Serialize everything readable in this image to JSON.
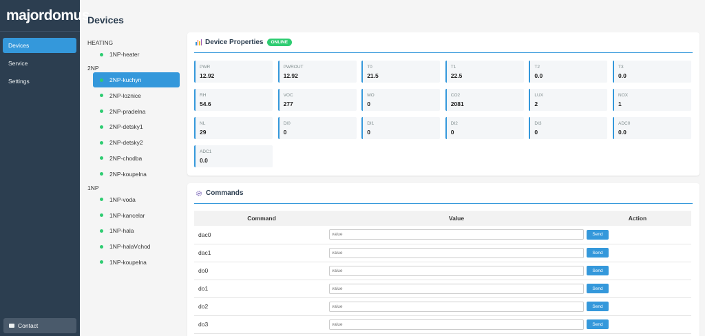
{
  "app": {
    "logo": "majordomus"
  },
  "sidebar": {
    "items": [
      {
        "label": "Devices",
        "active": true
      },
      {
        "label": "Service"
      },
      {
        "label": "Settings"
      }
    ],
    "contact_label": "Contact"
  },
  "page": {
    "title": "Devices"
  },
  "tree": {
    "groups": [
      {
        "label": "HEATING",
        "devices": [
          "1NP-heater"
        ]
      },
      {
        "label": "2NP",
        "devices": [
          "2NP-kuchyn",
          "2NP-loznice",
          "2NP-pradelna",
          "2NP-detsky1",
          "2NP-detsky2",
          "2NP-chodba",
          "2NP-koupelna"
        ]
      },
      {
        "label": "1NP",
        "devices": [
          "1NP-voda",
          "1NP-kancelar",
          "1NP-hala",
          "1NP-halaVchod",
          "1NP-koupelna"
        ]
      }
    ],
    "selected": "2NP-kuchyn"
  },
  "properties": {
    "title": "Device Properties",
    "status": "ONLINE",
    "items": [
      {
        "name": "PWR",
        "value": "12.92"
      },
      {
        "name": "PWROUT",
        "value": "12.92"
      },
      {
        "name": "T0",
        "value": "21.5"
      },
      {
        "name": "T1",
        "value": "22.5"
      },
      {
        "name": "T2",
        "value": "0.0"
      },
      {
        "name": "T3",
        "value": "0.0"
      },
      {
        "name": "RH",
        "value": "54.6"
      },
      {
        "name": "VOC",
        "value": "277"
      },
      {
        "name": "MO",
        "value": "0"
      },
      {
        "name": "CO2",
        "value": "2081"
      },
      {
        "name": "LUX",
        "value": "2"
      },
      {
        "name": "NOX",
        "value": "1"
      },
      {
        "name": "NL",
        "value": "29"
      },
      {
        "name": "DI0",
        "value": "0"
      },
      {
        "name": "DI1",
        "value": "0"
      },
      {
        "name": "DI2",
        "value": "0"
      },
      {
        "name": "DI3",
        "value": "0"
      },
      {
        "name": "ADC0",
        "value": "0.0"
      },
      {
        "name": "ADC1",
        "value": "0.0"
      }
    ]
  },
  "commands": {
    "title": "Commands",
    "headers": [
      "Command",
      "Value",
      "Action"
    ],
    "placeholder": "value",
    "send_label": "Send",
    "rows": [
      "dac0",
      "dac1",
      "do0",
      "do1",
      "do2",
      "do3"
    ]
  },
  "colors": {
    "sidebar": "#2c3e50",
    "accent": "#3498db",
    "online": "#2ecc71"
  },
  "icons": {
    "contact": "id-card-icon",
    "properties": "bar-chart-icon",
    "commands": "gear-icon",
    "device_status": "status-dot-icon"
  }
}
